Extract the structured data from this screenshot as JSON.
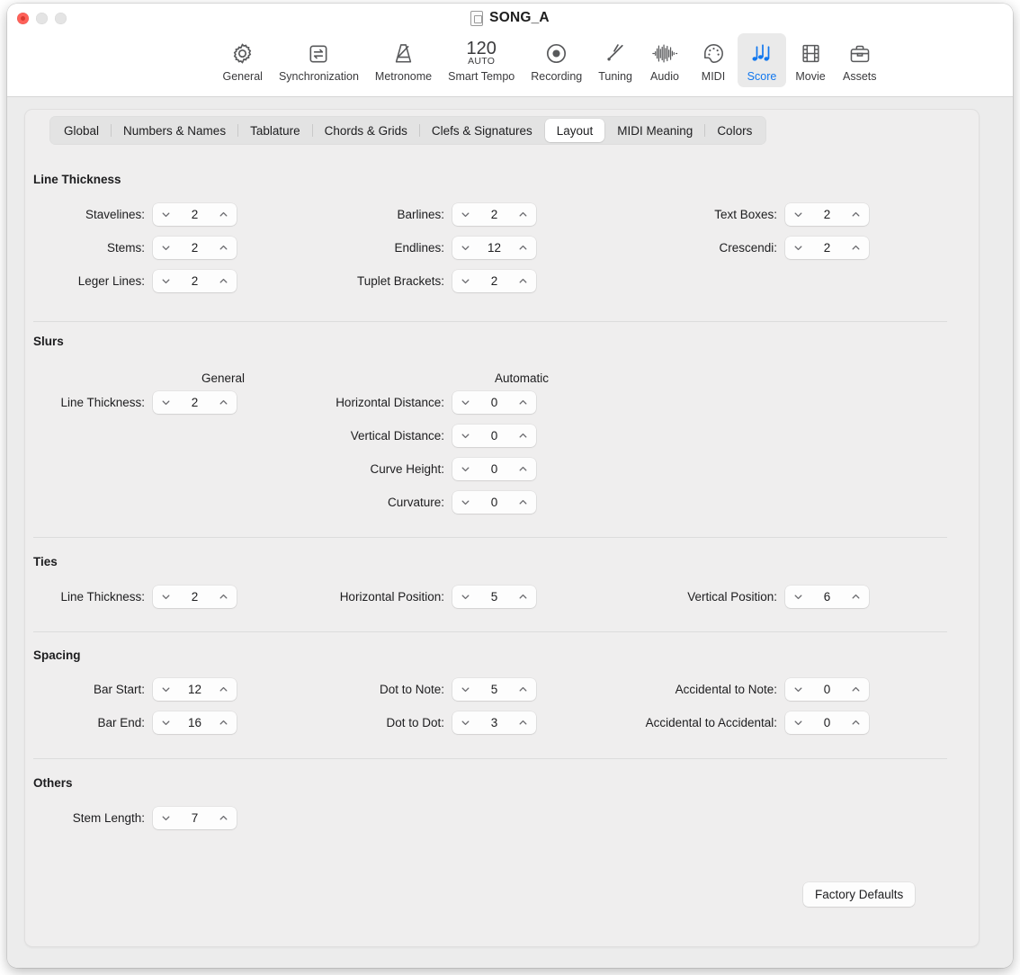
{
  "window": {
    "title": "SONG_A",
    "doc_icon": "document-icon",
    "traffic_lights": [
      "close",
      "minimize",
      "maximize"
    ]
  },
  "toolbar": {
    "items": [
      {
        "label": "General",
        "icon": "gear-icon",
        "selected": false
      },
      {
        "label": "Synchronization",
        "icon": "sync-arrows-icon",
        "selected": false
      },
      {
        "label": "Metronome",
        "icon": "metronome-icon",
        "selected": false
      },
      {
        "label": "Smart Tempo",
        "icon": "tempo-icon",
        "selected": false,
        "tempo_value": "120",
        "tempo_mode": "AUTO"
      },
      {
        "label": "Recording",
        "icon": "record-circle-icon",
        "selected": false
      },
      {
        "label": "Tuning",
        "icon": "tuning-fork-icon",
        "selected": false
      },
      {
        "label": "Audio",
        "icon": "waveform-icon",
        "selected": false
      },
      {
        "label": "MIDI",
        "icon": "midi-port-icon",
        "selected": false
      },
      {
        "label": "Score",
        "icon": "music-notes-icon",
        "selected": true
      },
      {
        "label": "Movie",
        "icon": "film-strip-icon",
        "selected": false
      },
      {
        "label": "Assets",
        "icon": "briefcase-icon",
        "selected": false
      }
    ],
    "accent_color": "#1177ee"
  },
  "tabs": [
    {
      "label": "Global",
      "active": false
    },
    {
      "label": "Numbers & Names",
      "active": false
    },
    {
      "label": "Tablature",
      "active": false
    },
    {
      "label": "Chords & Grids",
      "active": false
    },
    {
      "label": "Clefs & Signatures",
      "active": false
    },
    {
      "label": "Layout",
      "active": true
    },
    {
      "label": "MIDI Meaning",
      "active": false
    },
    {
      "label": "Colors",
      "active": false
    }
  ],
  "sections": {
    "line_thickness": {
      "title": "Line Thickness",
      "fields": [
        {
          "label": "Stavelines:",
          "value": "2"
        },
        {
          "label": "Stems:",
          "value": "2"
        },
        {
          "label": "Leger Lines:",
          "value": "2"
        },
        {
          "label": "Barlines:",
          "value": "2"
        },
        {
          "label": "Endlines:",
          "value": "12"
        },
        {
          "label": "Tuplet Brackets:",
          "value": "2"
        },
        {
          "label": "Text Boxes:",
          "value": "2"
        },
        {
          "label": "Crescendi:",
          "value": "2"
        }
      ]
    },
    "slurs": {
      "title": "Slurs",
      "col_general": "General",
      "col_automatic": "Automatic",
      "fields": [
        {
          "label": "Line Thickness:",
          "value": "2"
        },
        {
          "label": "Horizontal Distance:",
          "value": "0"
        },
        {
          "label": "Vertical Distance:",
          "value": "0"
        },
        {
          "label": "Curve Height:",
          "value": "0"
        },
        {
          "label": "Curvature:",
          "value": "0"
        }
      ]
    },
    "ties": {
      "title": "Ties",
      "fields": [
        {
          "label": "Line Thickness:",
          "value": "2"
        },
        {
          "label": "Horizontal Position:",
          "value": "5"
        },
        {
          "label": "Vertical Position:",
          "value": "6"
        }
      ]
    },
    "spacing": {
      "title": "Spacing",
      "fields": [
        {
          "label": "Bar Start:",
          "value": "12"
        },
        {
          "label": "Bar End:",
          "value": "16"
        },
        {
          "label": "Dot to Note:",
          "value": "5"
        },
        {
          "label": "Dot to Dot:",
          "value": "3"
        },
        {
          "label": "Accidental to Note:",
          "value": "0"
        },
        {
          "label": "Accidental to Accidental:",
          "value": "0"
        }
      ]
    },
    "others": {
      "title": "Others",
      "fields": [
        {
          "label": "Stem Length:",
          "value": "7"
        }
      ]
    }
  },
  "footer": {
    "factory_defaults_label": "Factory Defaults"
  }
}
